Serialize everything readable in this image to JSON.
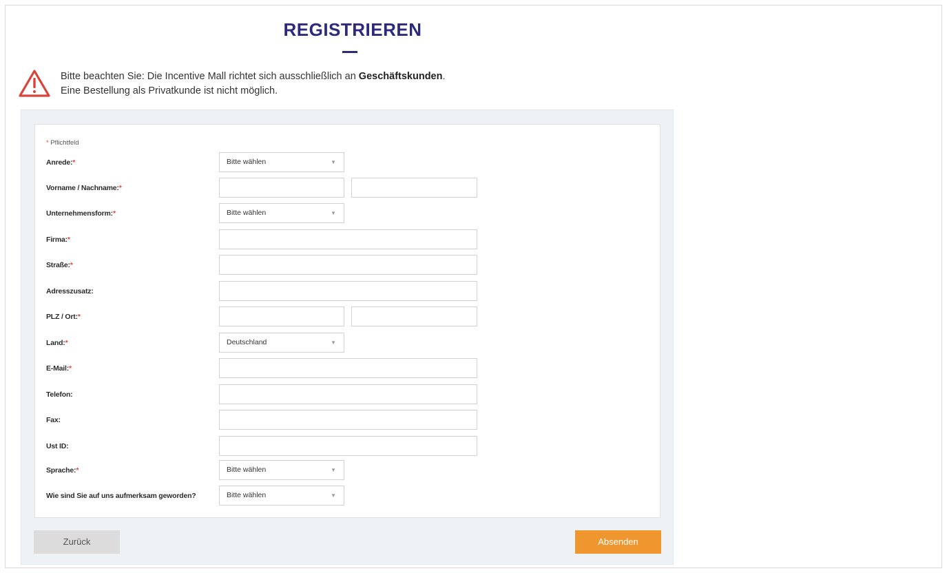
{
  "page": {
    "title": "REGISTRIEREN"
  },
  "notice": {
    "line1_prefix": "Bitte beachten Sie: Die Incentive Mall richtet sich ausschließlich an ",
    "line1_bold": "Geschäftskunden",
    "line1_suffix": ".",
    "line2": "Eine Bestellung als Privatkunde ist nicht möglich.",
    "icon": "warning-triangle-icon",
    "icon_color": "#d9433a"
  },
  "form": {
    "required_marker": "*",
    "required_note": "Pflichtfeld",
    "fields": {
      "anrede": {
        "label": "Anrede:",
        "value": "Bitte wählen"
      },
      "name": {
        "label": "Vorname / Nachname:",
        "first_value": "",
        "last_value": ""
      },
      "unternehmensform": {
        "label": "Unternehmensform:",
        "value": "Bitte wählen"
      },
      "firma": {
        "label": "Firma:",
        "value": ""
      },
      "strasse": {
        "label": "Straße:",
        "value": ""
      },
      "adresszusatz": {
        "label": "Adresszusatz:",
        "value": ""
      },
      "plz_ort": {
        "label": "PLZ / Ort:",
        "plz_value": "",
        "ort_value": ""
      },
      "land": {
        "label": "Land:",
        "value": "Deutschland"
      },
      "email": {
        "label": "E-Mail:",
        "value": ""
      },
      "telefon": {
        "label": "Telefon:",
        "value": ""
      },
      "fax": {
        "label": "Fax:",
        "value": ""
      },
      "ust_id": {
        "label": "Ust ID:",
        "value": ""
      },
      "sprache": {
        "label": "Sprache:",
        "value": "Bitte wählen"
      },
      "quelle": {
        "label": "Wie sind Sie auf uns aufmerksam geworden?",
        "value": "Bitte wählen"
      }
    }
  },
  "buttons": {
    "back": "Zurück",
    "submit": "Absenden"
  },
  "colors": {
    "title": "#2c2a7c",
    "accent": "#f0962f",
    "required": "#e0483d"
  }
}
